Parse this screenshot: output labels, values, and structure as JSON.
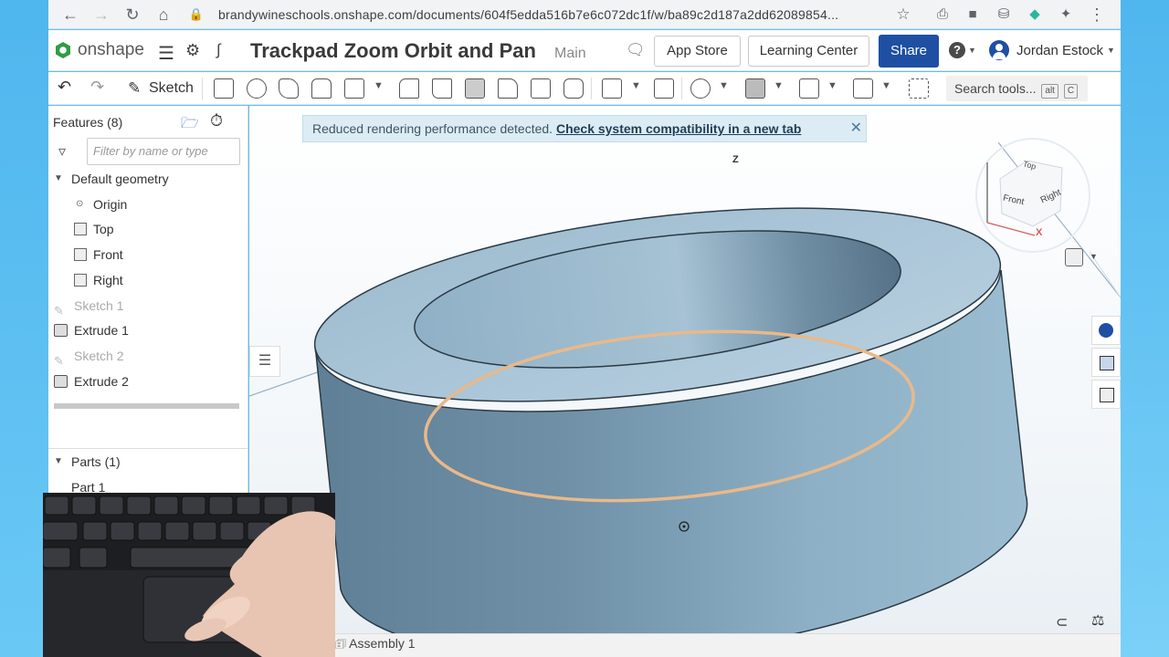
{
  "browser": {
    "url": "brandywineschools.onshape.com/documents/604f5edda516b7e6c072dc1f/w/ba89c2d187a2dd62089854...",
    "icons": [
      "back-icon",
      "forward-icon",
      "reload-icon",
      "home-icon",
      "lock-icon",
      "star-icon",
      "extension-icon",
      "menu-dots-icon"
    ]
  },
  "header": {
    "logo_text": "onshape",
    "doc_title": "Trackpad Zoom Orbit and Pan",
    "doc_branch": "Main",
    "app_store": "App Store",
    "learning_center": "Learning Center",
    "share": "Share",
    "user": "Jordan Estock",
    "help_icon": "?"
  },
  "toolbar": {
    "sketch": "Sketch",
    "search": "Search tools...",
    "search_key1": "alt",
    "search_key2": "C"
  },
  "panel": {
    "features_title": "Features (8)",
    "filter_placeholder": "Filter by name or type",
    "default_geometry": "Default geometry",
    "items": [
      {
        "label": "Origin"
      },
      {
        "label": "Top"
      },
      {
        "label": "Front"
      },
      {
        "label": "Right"
      },
      {
        "label": "Sketch 1"
      },
      {
        "label": "Extrude 1"
      },
      {
        "label": "Sketch 2"
      },
      {
        "label": "Extrude 2"
      }
    ],
    "parts_title": "Parts (1)",
    "part_1": "Part 1"
  },
  "graphics": {
    "banner_text": "Reduced rendering performance detected.",
    "banner_link": "Check system compatibility in a new tab",
    "viewcube": {
      "top": "Top",
      "front": "Front",
      "right": "Right",
      "axis_z": "Z",
      "axis_x": "X"
    }
  },
  "tabs": {
    "assembly": "Assembly 1"
  },
  "colors": {
    "share_button": "#1f4fa3",
    "part_body": "#7f9fb5",
    "selection_edge": "#e8b98a",
    "banner_bg": "#dcecf5"
  }
}
